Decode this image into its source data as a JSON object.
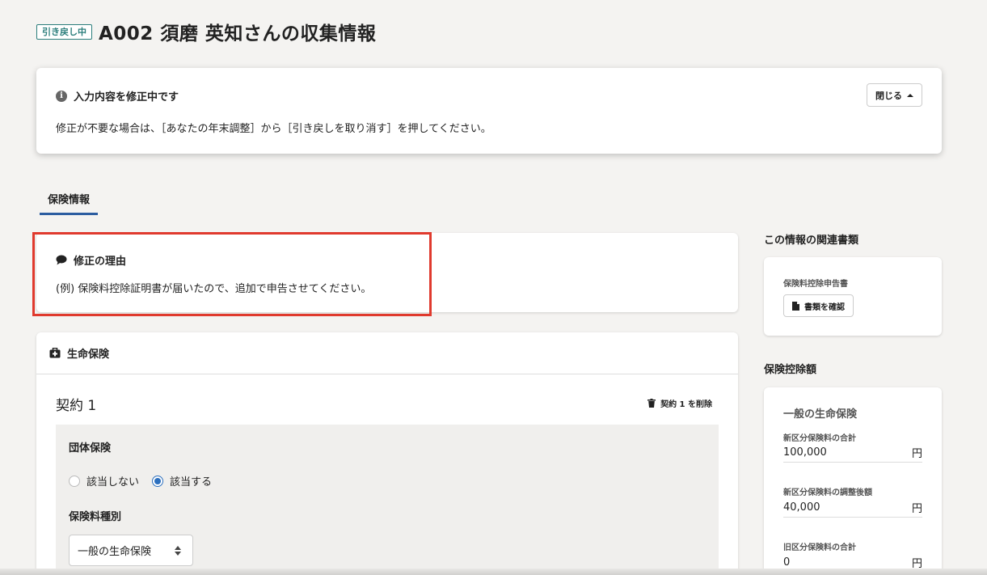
{
  "header": {
    "status_tag": "引き戻し中",
    "title": "A002 須磨 英知さんの収集情報"
  },
  "notice": {
    "title": "入力内容を修正中です",
    "body": "修正が不要な場合は、［あなたの年末調整］から［引き戻しを取り消す］を押してください。",
    "close_label": "閉じる"
  },
  "tabs": [
    {
      "label": "保険情報",
      "active": true
    }
  ],
  "reason": {
    "title": "修正の理由",
    "body": "(例) 保険料控除証明書が届いたので、追加で申告させてください。"
  },
  "life_insurance": {
    "title": "生命保険",
    "contract_title": "契約 1",
    "delete_label": "契約 1 を削除",
    "group_label": "団体保険",
    "radio_options": [
      "該当しない",
      "該当する"
    ],
    "radio_selected": "該当する",
    "type_label": "保険料種別",
    "type_value": "一般の生命保険"
  },
  "related_docs": {
    "heading": "この情報の関連書類",
    "doc_name": "保険料控除申告書",
    "check_button": "書類を確認"
  },
  "deduction": {
    "heading": "保険控除額",
    "section_title": "一般の生命保険",
    "rows": [
      {
        "label": "新区分保険料の合計",
        "value": "100,000",
        "unit": "円"
      },
      {
        "label": "新区分保険料の調整後額",
        "value": "40,000",
        "unit": "円"
      },
      {
        "label": "旧区分保険料の合計",
        "value": "0",
        "unit": "円"
      }
    ]
  },
  "colors": {
    "accent": "#2c5da0",
    "status_tag": "#2a7d7b",
    "highlight": "#e03a2e",
    "background": "#f4f3f1"
  }
}
